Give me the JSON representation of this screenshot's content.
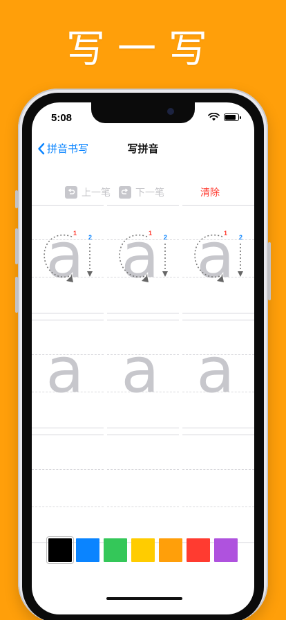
{
  "promo": {
    "title": "写一写"
  },
  "status_bar": {
    "time": "5:08",
    "battery_level": 0.85
  },
  "nav": {
    "back_label": "拼音书写",
    "title": "写拼音"
  },
  "toolbar": {
    "prev_label": "上一笔",
    "next_label": "下一笔",
    "clear_label": "清除"
  },
  "practice": {
    "letter": "a",
    "stroke_numbers": [
      "1",
      "2"
    ],
    "stroke_colors": [
      "#FF3B30",
      "#0A84FF"
    ]
  },
  "palette": {
    "colors": [
      "#000000",
      "#0A84FF",
      "#34C759",
      "#FFCC00",
      "#FF9F0A",
      "#FF3B30",
      "#AF52DE"
    ],
    "selected_index": 0
  },
  "colors": {
    "accent": "#0A84FF",
    "danger": "#FF3B30",
    "background": "#FF9F0A"
  }
}
